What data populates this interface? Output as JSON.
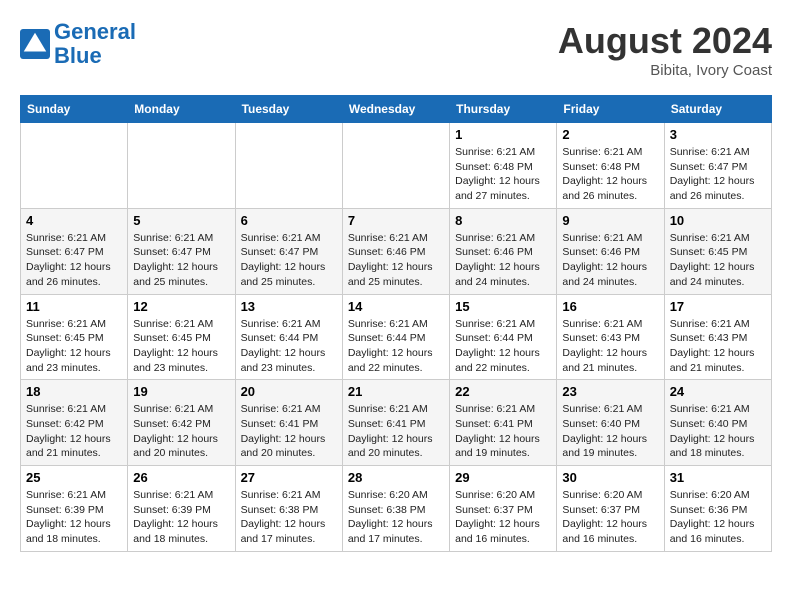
{
  "header": {
    "logo_line1": "General",
    "logo_line2": "Blue",
    "month_year": "August 2024",
    "location": "Bibita, Ivory Coast"
  },
  "days_of_week": [
    "Sunday",
    "Monday",
    "Tuesday",
    "Wednesday",
    "Thursday",
    "Friday",
    "Saturday"
  ],
  "weeks": [
    [
      {
        "day": "",
        "info": ""
      },
      {
        "day": "",
        "info": ""
      },
      {
        "day": "",
        "info": ""
      },
      {
        "day": "",
        "info": ""
      },
      {
        "day": "1",
        "info": "Sunrise: 6:21 AM\nSunset: 6:48 PM\nDaylight: 12 hours and 27 minutes."
      },
      {
        "day": "2",
        "info": "Sunrise: 6:21 AM\nSunset: 6:48 PM\nDaylight: 12 hours and 26 minutes."
      },
      {
        "day": "3",
        "info": "Sunrise: 6:21 AM\nSunset: 6:47 PM\nDaylight: 12 hours and 26 minutes."
      }
    ],
    [
      {
        "day": "4",
        "info": "Sunrise: 6:21 AM\nSunset: 6:47 PM\nDaylight: 12 hours and 26 minutes."
      },
      {
        "day": "5",
        "info": "Sunrise: 6:21 AM\nSunset: 6:47 PM\nDaylight: 12 hours and 25 minutes."
      },
      {
        "day": "6",
        "info": "Sunrise: 6:21 AM\nSunset: 6:47 PM\nDaylight: 12 hours and 25 minutes."
      },
      {
        "day": "7",
        "info": "Sunrise: 6:21 AM\nSunset: 6:46 PM\nDaylight: 12 hours and 25 minutes."
      },
      {
        "day": "8",
        "info": "Sunrise: 6:21 AM\nSunset: 6:46 PM\nDaylight: 12 hours and 24 minutes."
      },
      {
        "day": "9",
        "info": "Sunrise: 6:21 AM\nSunset: 6:46 PM\nDaylight: 12 hours and 24 minutes."
      },
      {
        "day": "10",
        "info": "Sunrise: 6:21 AM\nSunset: 6:45 PM\nDaylight: 12 hours and 24 minutes."
      }
    ],
    [
      {
        "day": "11",
        "info": "Sunrise: 6:21 AM\nSunset: 6:45 PM\nDaylight: 12 hours and 23 minutes."
      },
      {
        "day": "12",
        "info": "Sunrise: 6:21 AM\nSunset: 6:45 PM\nDaylight: 12 hours and 23 minutes."
      },
      {
        "day": "13",
        "info": "Sunrise: 6:21 AM\nSunset: 6:44 PM\nDaylight: 12 hours and 23 minutes."
      },
      {
        "day": "14",
        "info": "Sunrise: 6:21 AM\nSunset: 6:44 PM\nDaylight: 12 hours and 22 minutes."
      },
      {
        "day": "15",
        "info": "Sunrise: 6:21 AM\nSunset: 6:44 PM\nDaylight: 12 hours and 22 minutes."
      },
      {
        "day": "16",
        "info": "Sunrise: 6:21 AM\nSunset: 6:43 PM\nDaylight: 12 hours and 21 minutes."
      },
      {
        "day": "17",
        "info": "Sunrise: 6:21 AM\nSunset: 6:43 PM\nDaylight: 12 hours and 21 minutes."
      }
    ],
    [
      {
        "day": "18",
        "info": "Sunrise: 6:21 AM\nSunset: 6:42 PM\nDaylight: 12 hours and 21 minutes."
      },
      {
        "day": "19",
        "info": "Sunrise: 6:21 AM\nSunset: 6:42 PM\nDaylight: 12 hours and 20 minutes."
      },
      {
        "day": "20",
        "info": "Sunrise: 6:21 AM\nSunset: 6:41 PM\nDaylight: 12 hours and 20 minutes."
      },
      {
        "day": "21",
        "info": "Sunrise: 6:21 AM\nSunset: 6:41 PM\nDaylight: 12 hours and 20 minutes."
      },
      {
        "day": "22",
        "info": "Sunrise: 6:21 AM\nSunset: 6:41 PM\nDaylight: 12 hours and 19 minutes."
      },
      {
        "day": "23",
        "info": "Sunrise: 6:21 AM\nSunset: 6:40 PM\nDaylight: 12 hours and 19 minutes."
      },
      {
        "day": "24",
        "info": "Sunrise: 6:21 AM\nSunset: 6:40 PM\nDaylight: 12 hours and 18 minutes."
      }
    ],
    [
      {
        "day": "25",
        "info": "Sunrise: 6:21 AM\nSunset: 6:39 PM\nDaylight: 12 hours and 18 minutes."
      },
      {
        "day": "26",
        "info": "Sunrise: 6:21 AM\nSunset: 6:39 PM\nDaylight: 12 hours and 18 minutes."
      },
      {
        "day": "27",
        "info": "Sunrise: 6:21 AM\nSunset: 6:38 PM\nDaylight: 12 hours and 17 minutes."
      },
      {
        "day": "28",
        "info": "Sunrise: 6:20 AM\nSunset: 6:38 PM\nDaylight: 12 hours and 17 minutes."
      },
      {
        "day": "29",
        "info": "Sunrise: 6:20 AM\nSunset: 6:37 PM\nDaylight: 12 hours and 16 minutes."
      },
      {
        "day": "30",
        "info": "Sunrise: 6:20 AM\nSunset: 6:37 PM\nDaylight: 12 hours and 16 minutes."
      },
      {
        "day": "31",
        "info": "Sunrise: 6:20 AM\nSunset: 6:36 PM\nDaylight: 12 hours and 16 minutes."
      }
    ]
  ]
}
